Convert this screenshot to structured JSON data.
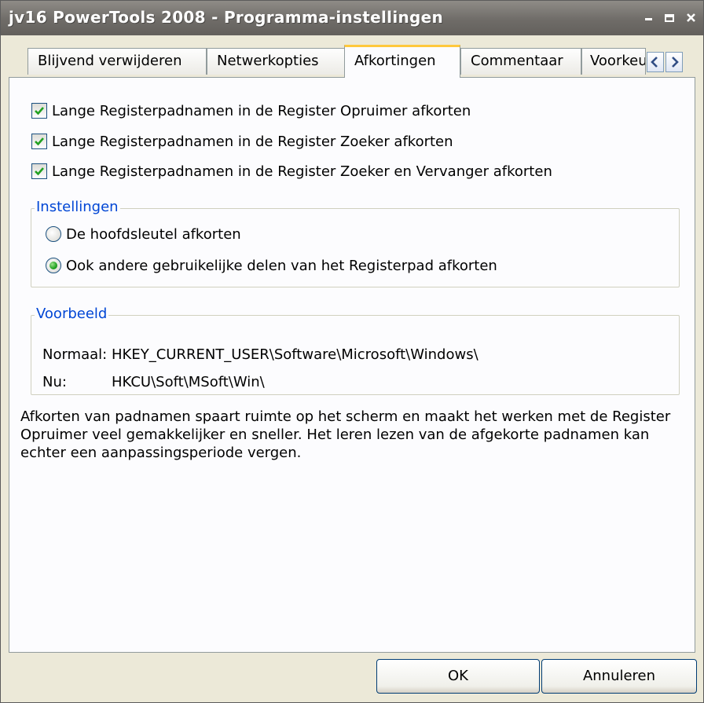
{
  "window": {
    "title": "jv16 PowerTools 2008 - Programma-instellingen",
    "controls": {
      "minimize": "‒",
      "maximize": "▫",
      "close": "×"
    }
  },
  "tabs": [
    {
      "label": "Blijvend verwijderen",
      "active": false
    },
    {
      "label": "Netwerkopties",
      "active": false
    },
    {
      "label": "Afkortingen",
      "active": true
    },
    {
      "label": "Commentaar",
      "active": false
    },
    {
      "label": "Voorkeuren",
      "active": false
    }
  ],
  "tab_scroll": {
    "left": "<",
    "right": ">"
  },
  "checkboxes": [
    {
      "label": "Lange Registerpadnamen in de Register Opruimer afkorten",
      "checked": true
    },
    {
      "label": "Lange Registerpadnamen in de Register Zoeker afkorten",
      "checked": true
    },
    {
      "label": "Lange Registerpadnamen in de Register Zoeker en Vervanger afkorten",
      "checked": true
    }
  ],
  "settings_group": {
    "legend": "Instellingen",
    "options": [
      {
        "label": "De hoofdsleutel afkorten",
        "selected": false
      },
      {
        "label": "Ook andere gebruikelijke delen van het Registerpad afkorten",
        "selected": true
      }
    ]
  },
  "example_group": {
    "legend": "Voorbeeld",
    "normal_label": "Normaal:",
    "normal_value": "HKEY_CURRENT_USER\\Software\\Microsoft\\Windows\\",
    "now_label": "Nu:",
    "now_value": "HKCU\\Soft\\MSoft\\Win\\"
  },
  "description": "Afkorten van padnamen spaart ruimte op het scherm en maakt het werken met de Register Opruimer veel gemakkelijker en sneller. Het leren lezen van de afgekorte padnamen kan echter een aanpassingsperiode vergen.",
  "buttons": {
    "ok": "OK",
    "cancel": "Annuleren"
  },
  "colors": {
    "titlebar": "#7a7772",
    "active_tab_accent": "#ffc83c",
    "group_legend": "#0046d5"
  }
}
